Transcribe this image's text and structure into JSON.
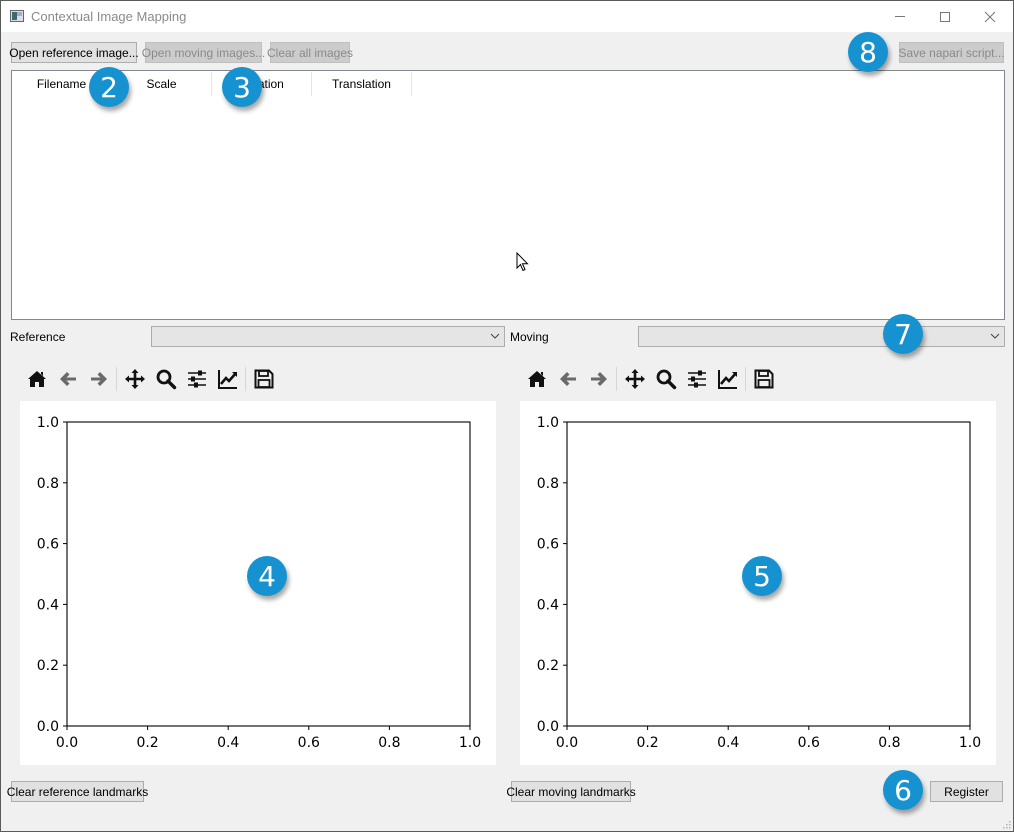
{
  "window": {
    "title": "Contextual Image Mapping",
    "controls": [
      "minimize",
      "maximize",
      "close"
    ]
  },
  "top_buttons": {
    "open_reference": "Open reference image...",
    "open_moving": "Open moving images...",
    "clear_all": "Clear all images",
    "save_script": "Save napari script..."
  },
  "table": {
    "columns": [
      "Filename",
      "Scale",
      "Rotation",
      "Translation"
    ],
    "rows": []
  },
  "selectors": {
    "reference_label": "Reference",
    "reference_value": "",
    "moving_label": "Moving",
    "moving_value": ""
  },
  "toolbar": {
    "icons": [
      "home-icon",
      "back-icon",
      "forward-icon",
      "pan-icon",
      "zoom-icon",
      "subplots-icon",
      "axes-edit-icon",
      "save-figure-icon"
    ]
  },
  "bottom_buttons": {
    "clear_reference": "Clear reference landmarks",
    "clear_moving": "Clear moving landmarks",
    "register": "Register"
  },
  "markers": {
    "m2": "2",
    "m3": "3",
    "m4": "4",
    "m5": "5",
    "m6": "6",
    "m7": "7",
    "m8": "8"
  },
  "chart_data": [
    {
      "type": "scatter",
      "name": "reference-plot",
      "title": "",
      "xlabel": "",
      "ylabel": "",
      "xlim": [
        0.0,
        1.0
      ],
      "ylim": [
        0.0,
        1.0
      ],
      "xticks": [
        "0.0",
        "0.2",
        "0.4",
        "0.6",
        "0.8",
        "1.0"
      ],
      "yticks": [
        "0.0",
        "0.2",
        "0.4",
        "0.6",
        "0.8",
        "1.0"
      ],
      "grid": false,
      "series": []
    },
    {
      "type": "scatter",
      "name": "moving-plot",
      "title": "",
      "xlabel": "",
      "ylabel": "",
      "xlim": [
        0.0,
        1.0
      ],
      "ylim": [
        0.0,
        1.0
      ],
      "xticks": [
        "0.0",
        "0.2",
        "0.4",
        "0.6",
        "0.8",
        "1.0"
      ],
      "yticks": [
        "0.0",
        "0.2",
        "0.4",
        "0.6",
        "0.8",
        "1.0"
      ],
      "grid": false,
      "series": []
    }
  ]
}
